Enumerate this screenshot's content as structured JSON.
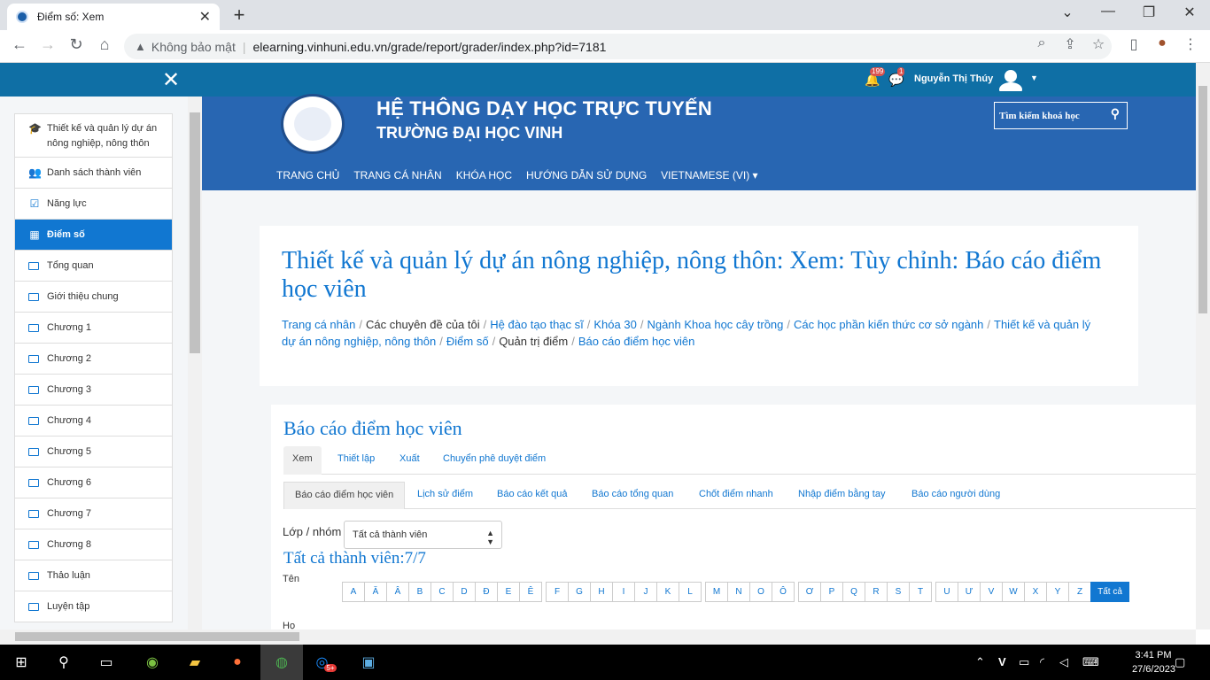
{
  "browser": {
    "tab_title": "Điểm số: Xem",
    "insecure_label": "Không bảo mật",
    "url": "elearning.vinhuni.edu.vn/grade/report/grader/index.php?id=7181"
  },
  "topbar": {
    "notif_count": "199",
    "msg_count": "1",
    "user_name": "Nguyễn Thị Thúy"
  },
  "sidebar": {
    "items": [
      {
        "label": "Thiết kế và quản lý dự án nông nghiệp, nông thôn",
        "icon": "graduation-cap-icon"
      },
      {
        "label": "Danh sách thành viên",
        "icon": "users-icon"
      },
      {
        "label": "Năng lực",
        "icon": "checkbox-icon"
      },
      {
        "label": "Điểm số",
        "icon": "table-icon"
      },
      {
        "label": "Tổng quan",
        "icon": "folder-icon"
      },
      {
        "label": "Giới thiệu chung",
        "icon": "folder-icon"
      },
      {
        "label": "Chương 1",
        "icon": "folder-icon"
      },
      {
        "label": "Chương 2",
        "icon": "folder-icon"
      },
      {
        "label": "Chương 3",
        "icon": "folder-icon"
      },
      {
        "label": "Chương 4",
        "icon": "folder-icon"
      },
      {
        "label": "Chương 5",
        "icon": "folder-icon"
      },
      {
        "label": "Chương 6",
        "icon": "folder-icon"
      },
      {
        "label": "Chương 7",
        "icon": "folder-icon"
      },
      {
        "label": "Chương 8",
        "icon": "folder-icon"
      },
      {
        "label": "Thảo luận",
        "icon": "folder-icon"
      },
      {
        "label": "Luyện tập",
        "icon": "folder-icon"
      }
    ]
  },
  "header": {
    "title": "HỆ THÔNG DẠY HỌC TRỰC TUYẾN",
    "subtitle": "TRƯỜNG ĐẠI HỌC VINH",
    "search_placeholder": "Tìm kiếm khoá học",
    "menu": [
      "TRANG CHỦ",
      "TRANG CÁ NHÂN",
      "KHÓA HỌC",
      "HƯỚNG DẪN SỬ DỤNG",
      "VIETNAMESE (VI) ▾"
    ]
  },
  "page": {
    "title": "Thiết kế và quản lý dự án nông nghiệp, nông thôn: Xem: Tùy chỉnh: Báo cáo điểm học viên",
    "breadcrumb": [
      {
        "text": "Trang cá nhân",
        "link": true
      },
      {
        "text": "Các chuyên đề của tôi",
        "link": false
      },
      {
        "text": "Hệ đào tạo thạc sĩ",
        "link": true
      },
      {
        "text": "Khóa 30",
        "link": true
      },
      {
        "text": "Ngành Khoa học cây trồng",
        "link": true
      },
      {
        "text": "Các học phần kiến thức cơ sở ngành",
        "link": true
      },
      {
        "text": "Thiết kế và quản lý dự án nông nghiệp, nông thôn",
        "link": true
      },
      {
        "text": "Điểm số",
        "link": true
      },
      {
        "text": "Quản trị điểm",
        "link": false
      },
      {
        "text": "Báo cáo điểm học viên",
        "link": true
      }
    ]
  },
  "report": {
    "heading": "Báo cáo điểm học viên",
    "tabs1": [
      "Xem",
      "Thiết lập",
      "Xuất",
      "Chuyển phê duyệt điểm"
    ],
    "tabs2": [
      "Báo cáo điểm học viên",
      "Lịch sử điểm",
      "Báo cáo kết quả",
      "Báo cáo tổng quan",
      "Chốt điểm nhanh",
      "Nhập điểm bằng tay",
      "Báo cáo người dùng"
    ],
    "group_label": "Lớp / nhóm",
    "group_value": "Tất cả thành viên",
    "all_members": "Tất cả thành viên:7/7",
    "first_name_label": "Tên",
    "last_name_label": "Họ",
    "letters": [
      "A",
      "Ă",
      "Â",
      "B",
      "C",
      "D",
      "Đ",
      "E",
      "Ê",
      "F",
      "G",
      "H",
      "I",
      "J",
      "K",
      "L",
      "M",
      "N",
      "O",
      "Ô",
      "Ơ",
      "P",
      "Q",
      "R",
      "S",
      "T",
      "U",
      "Ư",
      "V",
      "W",
      "X",
      "Y",
      "Z",
      "Tất cả"
    ]
  },
  "taskbar": {
    "time": "3:41 PM",
    "date": "27/6/2023",
    "zalo_badge": "5+",
    "lang": "V"
  }
}
